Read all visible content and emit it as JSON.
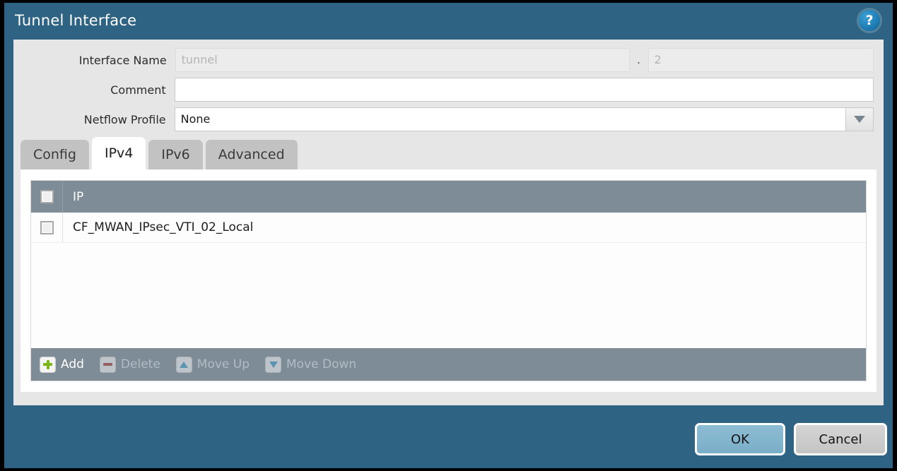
{
  "dialog": {
    "title": "Tunnel Interface",
    "help_icon": "help-circle-icon",
    "help_glyph": "?"
  },
  "form": {
    "interface_name": {
      "label": "Interface Name",
      "prefix_value": "tunnel",
      "separator": ".",
      "suffix_value": "2"
    },
    "comment": {
      "label": "Comment",
      "value": ""
    },
    "netflow_profile": {
      "label": "Netflow Profile",
      "value": "None",
      "caret_icon": "chevron-down-icon"
    }
  },
  "tabs": [
    {
      "label": "Config",
      "active": false
    },
    {
      "label": "IPv4",
      "active": true
    },
    {
      "label": "IPv6",
      "active": false
    },
    {
      "label": "Advanced",
      "active": false
    }
  ],
  "ip_table": {
    "columns": [
      "IP"
    ],
    "header_checkbox": "select-all-checkbox",
    "rows": [
      {
        "ip": "CF_MWAN_IPsec_VTI_02_Local",
        "checked": false
      }
    ],
    "toolbar": [
      {
        "label": "Add",
        "icon": "plus-icon",
        "enabled": true
      },
      {
        "label": "Delete",
        "icon": "minus-icon",
        "enabled": false
      },
      {
        "label": "Move Up",
        "icon": "arrow-up-icon",
        "enabled": false
      },
      {
        "label": "Move Down",
        "icon": "arrow-down-icon",
        "enabled": false
      }
    ]
  },
  "footer": {
    "ok_label": "OK",
    "cancel_label": "Cancel"
  },
  "colors": {
    "dialog_chrome": "#2e6384",
    "body_background": "#e6e6e6",
    "table_header": "#7e8c97",
    "accent_add": "#7cb518",
    "ok_button": "#82b4cd"
  }
}
